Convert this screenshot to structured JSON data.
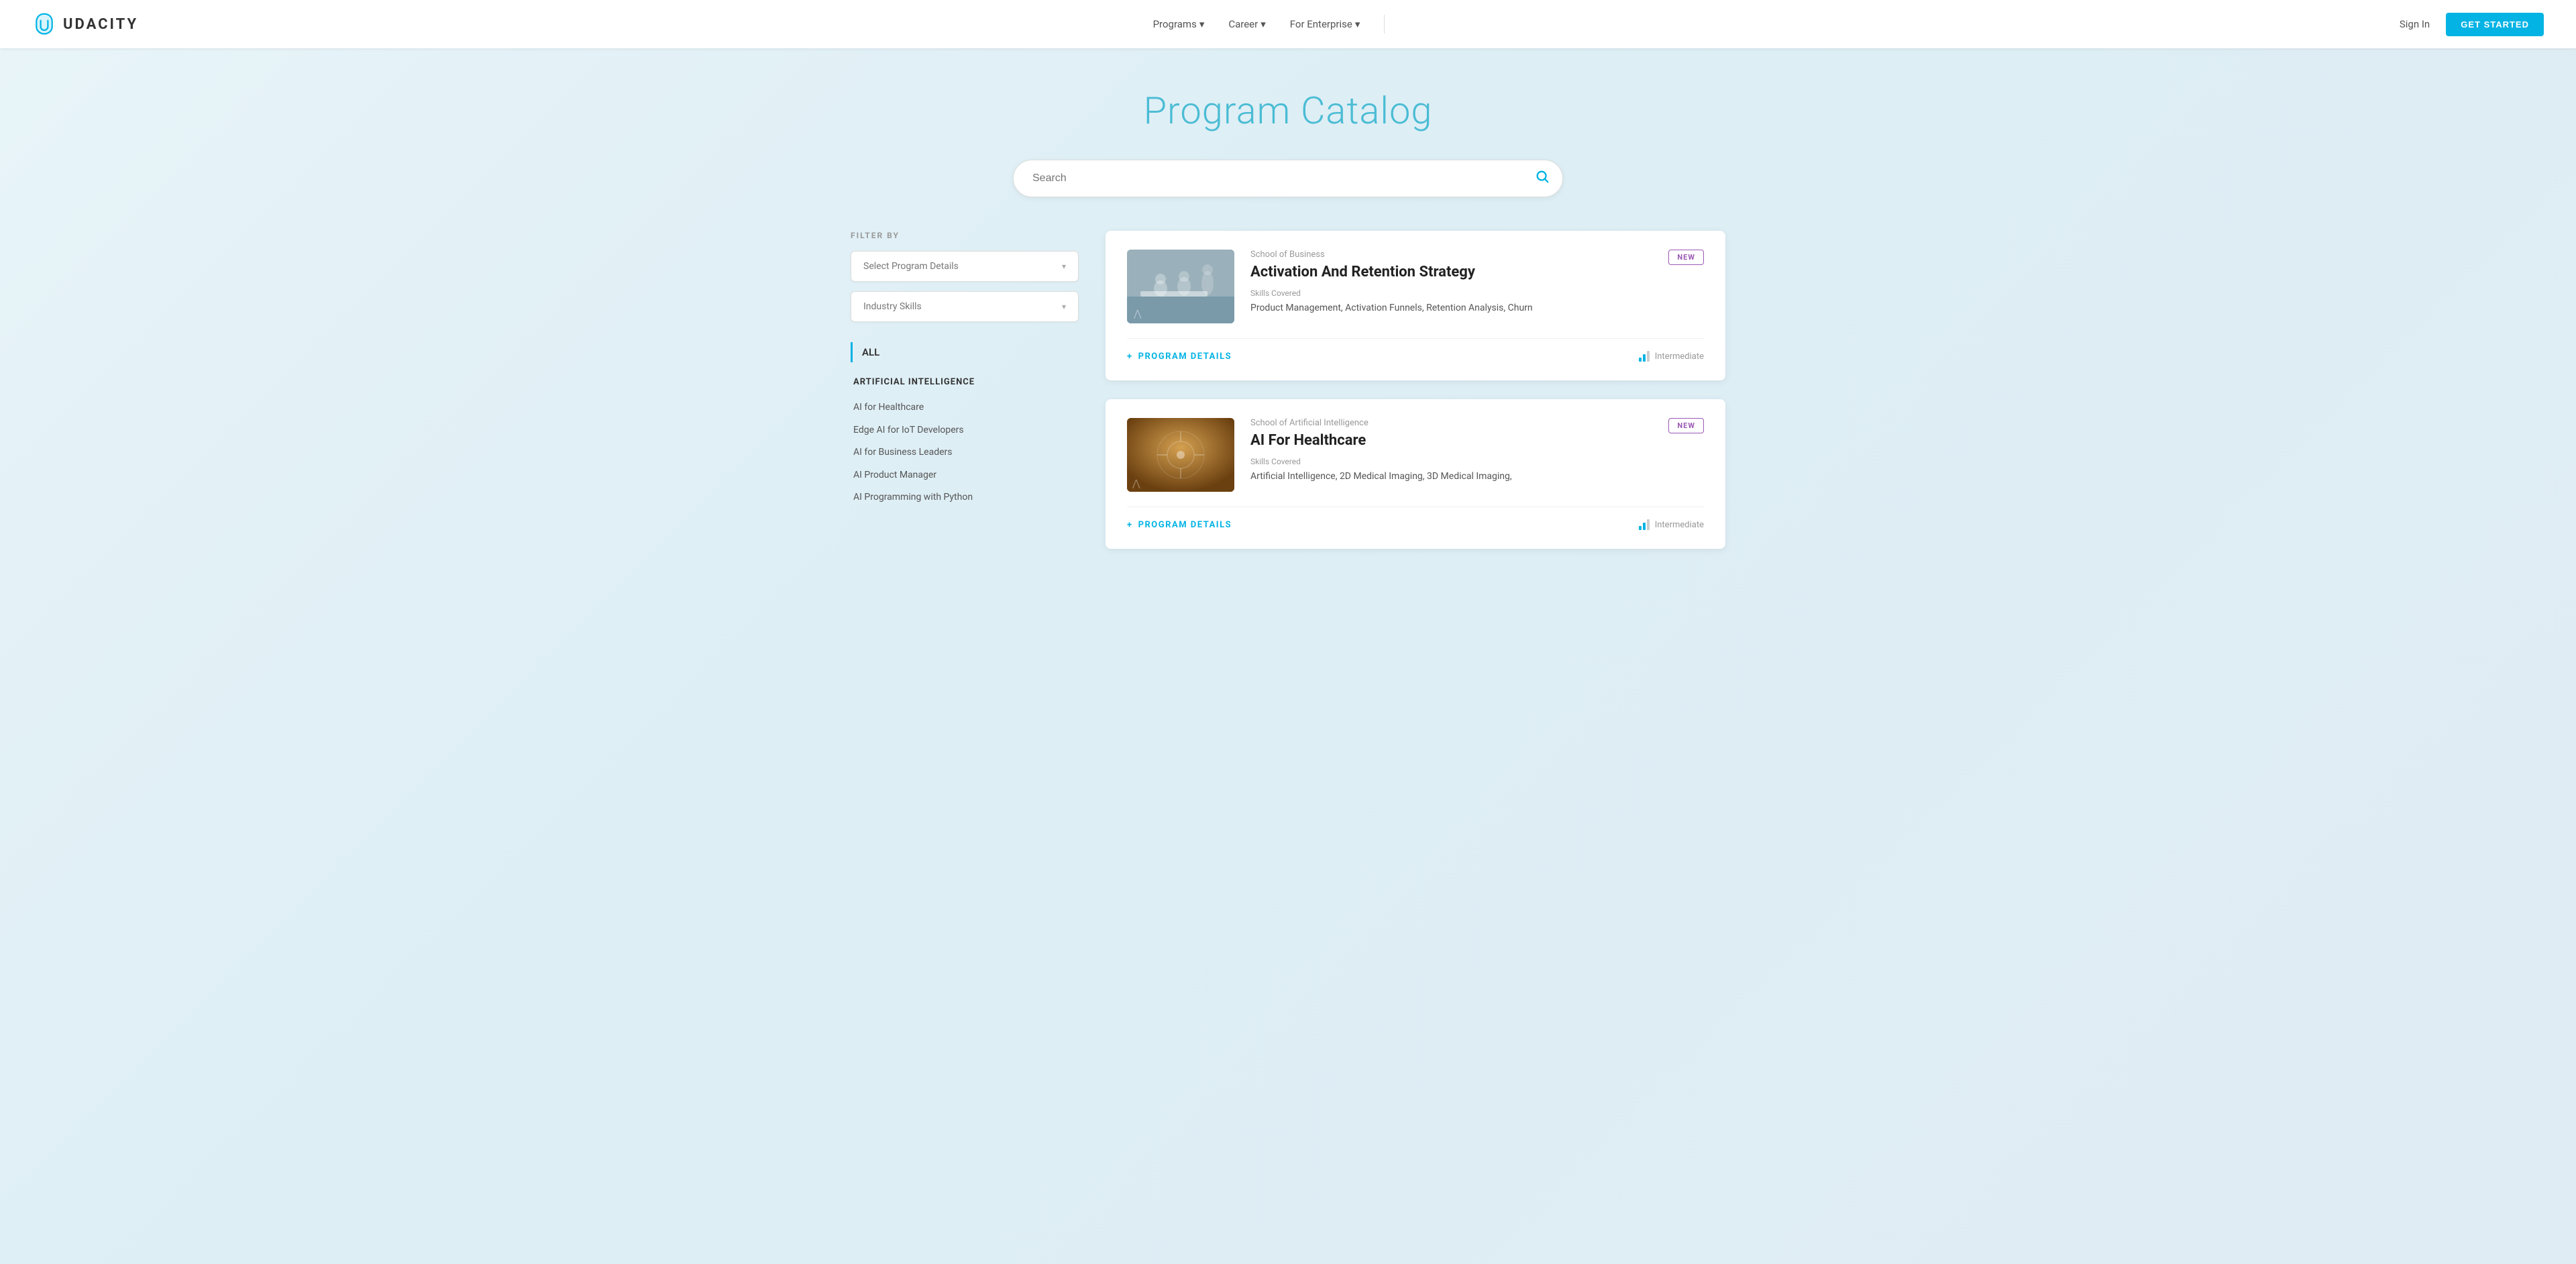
{
  "nav": {
    "logo_text": "UDACITY",
    "links": [
      {
        "label": "Programs",
        "has_arrow": true
      },
      {
        "label": "Career",
        "has_arrow": true
      },
      {
        "label": "For Enterprise",
        "has_arrow": true
      }
    ],
    "sign_in": "Sign In",
    "get_started": "GET STARTED"
  },
  "page": {
    "title": "Program Catalog"
  },
  "search": {
    "placeholder": "Search"
  },
  "filters": {
    "label": "FILTER BY",
    "program_details": "Select Program Details",
    "industry_skills": "Industry Skills"
  },
  "sidebar": {
    "all_label": "ALL",
    "sections": [
      {
        "title": "ARTIFICIAL INTELLIGENCE",
        "items": [
          "AI for Healthcare",
          "Edge AI for IoT Developers",
          "AI for Business Leaders",
          "AI Product Manager",
          "AI Programming with Python"
        ]
      }
    ]
  },
  "programs": [
    {
      "school": "School of Business",
      "title": "Activation And Retention Strategy",
      "is_new": true,
      "new_label": "NEW",
      "skills_label": "Skills Covered",
      "skills": "Product Management, Activation Funnels, Retention Analysis, Churn",
      "details_label": "PROGRAM DETAILS",
      "level": "Intermediate",
      "thumbnail_type": "business"
    },
    {
      "school": "School of Artificial Intelligence",
      "title": "AI For Healthcare",
      "is_new": true,
      "new_label": "NEW",
      "skills_label": "Skills Covered",
      "skills": "Artificial Intelligence, 2D Medical Imaging, 3D Medical Imaging,",
      "details_label": "PROGRAM DETAILS",
      "level": "Intermediate",
      "thumbnail_type": "ai"
    }
  ]
}
